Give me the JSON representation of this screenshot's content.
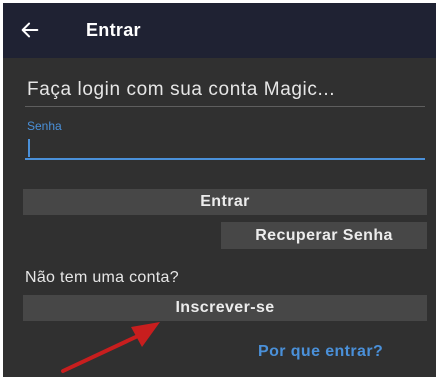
{
  "appbar": {
    "title": "Entrar",
    "back_icon": "arrow-left-icon"
  },
  "login": {
    "account_text": "Faça login com sua conta Magic...",
    "password_label": "Senha",
    "password_value": "",
    "submit_label": "Entrar",
    "recover_label": "Recuperar Senha"
  },
  "signup": {
    "prompt": "Não tem uma conta?",
    "button_label": "Inscrever-se",
    "why_link": "Por que entrar?"
  },
  "colors": {
    "appbar_bg": "#1f2233",
    "screen_bg": "#303030",
    "button_bg": "#474747",
    "accent": "#4a90d9",
    "annotation_arrow": "#c81e1e"
  }
}
